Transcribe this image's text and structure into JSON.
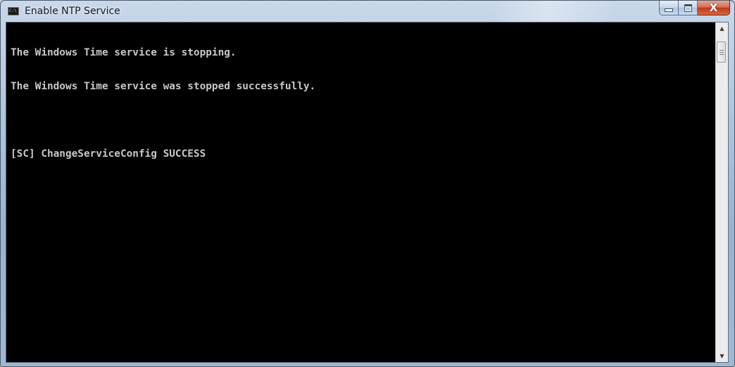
{
  "window": {
    "title": "Enable NTP Service",
    "icon": "cmd-icon",
    "icon_text": "C:\\",
    "controls": {
      "minimize": "minimize-icon",
      "maximize": "maximize-icon",
      "close": "close-icon",
      "close_glyph": "X"
    }
  },
  "console": {
    "lines": [
      "The Windows Time service is stopping.",
      "The Windows Time service was stopped successfully.",
      "",
      "[SC] ChangeServiceConfig SUCCESS"
    ],
    "text_color": "#c8c8c8",
    "background_color": "#000000"
  },
  "scrollbar": {
    "up_glyph": "▲",
    "down_glyph": "▼"
  }
}
